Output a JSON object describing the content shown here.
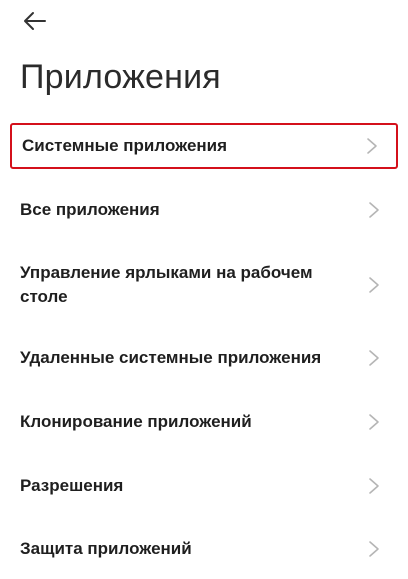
{
  "header": {
    "back_icon": "arrow-left-icon",
    "title": "Приложения"
  },
  "menu": {
    "items": [
      {
        "label": "Системные приложения",
        "highlighted": true,
        "icon": "chevron-right-icon"
      },
      {
        "label": "Все приложения",
        "highlighted": false,
        "icon": "chevron-right-icon"
      },
      {
        "label": "Управление ярлыками на рабочем столе",
        "highlighted": false,
        "icon": "chevron-right-icon"
      },
      {
        "label": "Удаленные системные приложения",
        "highlighted": false,
        "icon": "chevron-right-icon"
      },
      {
        "label": "Клонирование приложений",
        "highlighted": false,
        "icon": "chevron-right-icon"
      },
      {
        "label": "Разрешения",
        "highlighted": false,
        "icon": "chevron-right-icon"
      },
      {
        "label": "Защита приложений",
        "highlighted": false,
        "icon": "chevron-right-icon"
      }
    ]
  },
  "colors": {
    "highlight_border": "#d4101b",
    "chevron": "#b5b5b5",
    "text": "#1f1f1f"
  }
}
